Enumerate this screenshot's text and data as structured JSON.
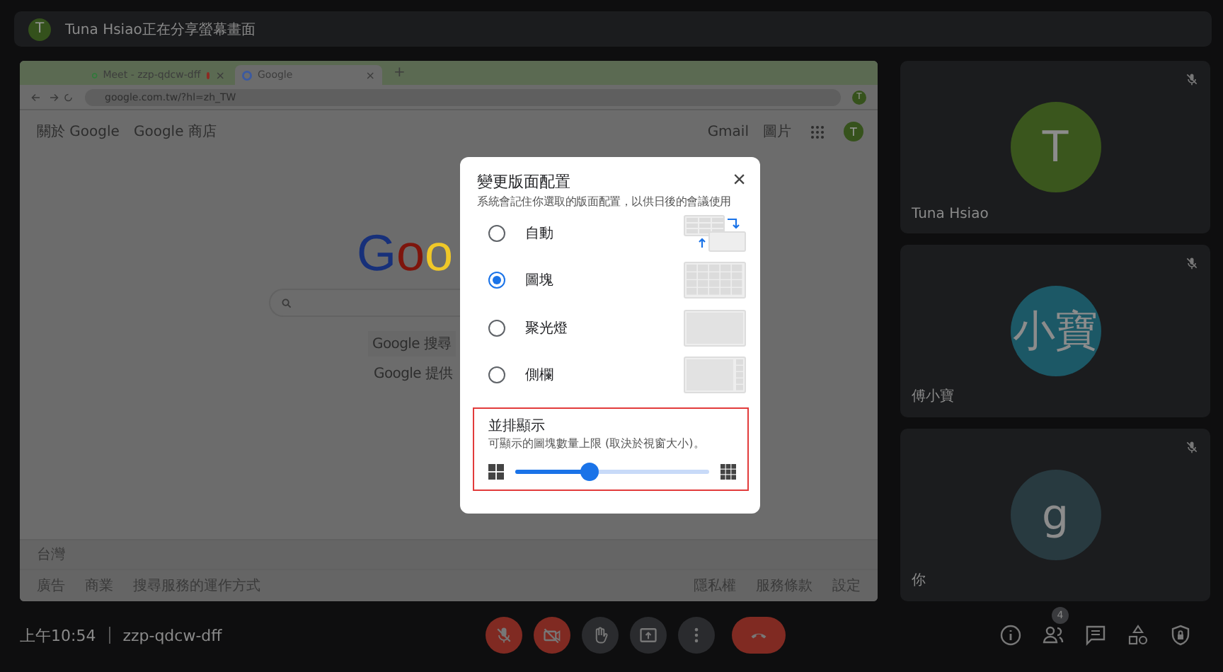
{
  "banner": {
    "avatar": "T",
    "text": "Tuna Hsiao正在分享螢幕畫面"
  },
  "shared_screen": {
    "tabs": [
      {
        "title": "Meet - zzp-qdcw-dff",
        "selected": false,
        "recording": true,
        "close": "×"
      },
      {
        "title": "Google",
        "selected": true,
        "recording": false,
        "close": "×"
      }
    ],
    "new_tab": "+",
    "address": "google.com.tw/?hl=zh_TW",
    "links_left": [
      "關於 Google",
      "Google 商店"
    ],
    "links_right": [
      "Gmail",
      "圖片"
    ],
    "profile": "T",
    "account_avatar": "T",
    "logo": "Goo",
    "search_button": "Google 搜尋",
    "offered_in": "Google 提供",
    "country": "台灣",
    "footer_left": [
      "廣告",
      "商業",
      "搜尋服務的運作方式"
    ],
    "footer_right": [
      "隱私權",
      "服務條款",
      "設定"
    ]
  },
  "dialog": {
    "title": "變更版面配置",
    "description": "系統會記住你選取的版面配置，以供日後的會議使用",
    "close": "×",
    "options": [
      {
        "label": "自動",
        "kind": "auto",
        "selected": false
      },
      {
        "label": "圖塊",
        "kind": "tiled",
        "selected": true
      },
      {
        "label": "聚光燈",
        "kind": "spotlight",
        "selected": false
      },
      {
        "label": "側欄",
        "kind": "sidebar",
        "selected": false
      }
    ],
    "tiles": {
      "title": "並排顯示",
      "description": "可顯示的圖塊數量上限 (取決於視窗大小)。",
      "level": 0.38
    }
  },
  "participants": [
    {
      "name": "Tuna Hsiao",
      "initials": "T",
      "color": "#3a561d",
      "muted": true
    },
    {
      "name": "傅小寶",
      "initials": "小寶",
      "color": "#1c5866",
      "muted": true
    },
    {
      "name": "你",
      "initials": "g",
      "color": "#283a40",
      "muted": true
    }
  ],
  "clock": "上午10:54",
  "meeting_code": "zzp-qdcw-dff",
  "controls": [
    {
      "kind": "mic",
      "on": false
    },
    {
      "kind": "camera",
      "on": false
    },
    {
      "kind": "hand",
      "on": false
    },
    {
      "kind": "present",
      "on": false
    },
    {
      "kind": "more",
      "on": false
    },
    {
      "kind": "leave"
    }
  ],
  "people_count": "4"
}
